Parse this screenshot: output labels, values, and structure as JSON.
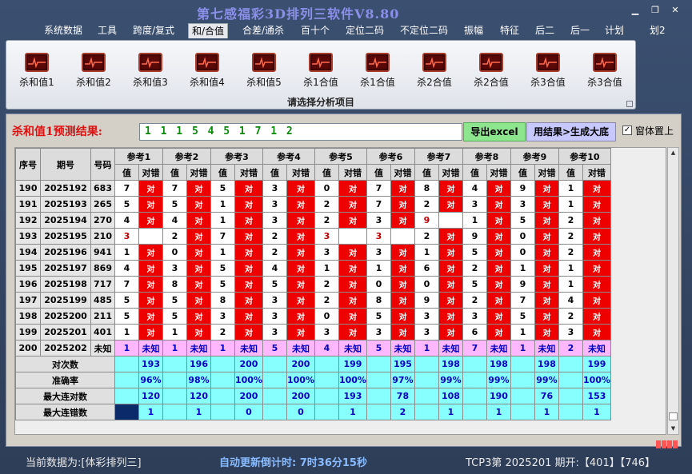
{
  "app": {
    "title": "第七感福彩3D排列三软件V8.80"
  },
  "menu": [
    "系统数据",
    "工具",
    "跨度/复式",
    "和/合值",
    "合差/通杀",
    "百十个",
    "定位二码",
    "不定位二码",
    "振幅",
    "特征",
    "后二",
    "后一",
    "计划",
    "划2"
  ],
  "ribbon": {
    "buttons": [
      "杀和值1",
      "杀和值2",
      "杀和值3",
      "杀和值4",
      "杀和值5",
      "杀1合值",
      "杀1合值",
      "杀2合值",
      "杀2合值",
      "杀3合值",
      "杀3合值"
    ],
    "caption": "请选择分析项目"
  },
  "result": {
    "label": "杀和值1预测结果:",
    "value": "1 1 1 5 4 5 1 7 1 2",
    "excel_btn": "导出excel",
    "gen_btn": "用结果>生成大底",
    "ontop_label": "窗体置上",
    "ontop_checked": "✓"
  },
  "table": {
    "headers": {
      "seq": "序号",
      "period": "期号",
      "number": "号码",
      "refs": [
        "参考1",
        "参考2",
        "参考3",
        "参考4",
        "参考5",
        "参考6",
        "参考7",
        "参考8",
        "参考9",
        "参考10"
      ],
      "val": "值",
      "judge": "对错"
    },
    "ok_text": "对",
    "rows": [
      {
        "seq": "190",
        "period": "2025192",
        "number": "683",
        "vals": [
          "7",
          "7",
          "5",
          "3",
          "0",
          "7",
          "8",
          "4",
          "9",
          "1"
        ],
        "ok": [
          1,
          1,
          1,
          1,
          1,
          1,
          1,
          1,
          1,
          1
        ]
      },
      {
        "seq": "191",
        "period": "2025193",
        "number": "265",
        "vals": [
          "5",
          "5",
          "1",
          "3",
          "2",
          "7",
          "2",
          "3",
          "3",
          "1"
        ],
        "ok": [
          1,
          1,
          1,
          1,
          1,
          1,
          1,
          1,
          1,
          1
        ]
      },
      {
        "seq": "192",
        "period": "2025194",
        "number": "270",
        "vals": [
          "4",
          "4",
          "1",
          "3",
          "2",
          "3",
          "9",
          "1",
          "5",
          "2"
        ],
        "ok": [
          1,
          1,
          1,
          1,
          1,
          1,
          0,
          1,
          1,
          1
        ]
      },
      {
        "seq": "193",
        "period": "2025195",
        "number": "210",
        "vals": [
          "3",
          "2",
          "7",
          "2",
          "3",
          "3",
          "2",
          "9",
          "0",
          "2"
        ],
        "ok": [
          0,
          1,
          1,
          1,
          0,
          0,
          1,
          1,
          1,
          1
        ]
      },
      {
        "seq": "194",
        "period": "2025196",
        "number": "941",
        "vals": [
          "1",
          "0",
          "1",
          "2",
          "3",
          "3",
          "1",
          "5",
          "0",
          "2"
        ],
        "ok": [
          1,
          1,
          1,
          1,
          1,
          1,
          1,
          1,
          1,
          1
        ]
      },
      {
        "seq": "195",
        "period": "2025197",
        "number": "869",
        "vals": [
          "4",
          "3",
          "5",
          "4",
          "1",
          "1",
          "6",
          "2",
          "1",
          "1"
        ],
        "ok": [
          1,
          1,
          1,
          1,
          1,
          1,
          1,
          1,
          1,
          1
        ]
      },
      {
        "seq": "196",
        "period": "2025198",
        "number": "717",
        "vals": [
          "7",
          "8",
          "5",
          "5",
          "2",
          "0",
          "0",
          "5",
          "9",
          "1"
        ],
        "ok": [
          1,
          1,
          1,
          1,
          1,
          1,
          1,
          1,
          1,
          1
        ]
      },
      {
        "seq": "197",
        "period": "2025199",
        "number": "485",
        "vals": [
          "5",
          "5",
          "8",
          "3",
          "2",
          "8",
          "9",
          "2",
          "7",
          "4"
        ],
        "ok": [
          1,
          1,
          1,
          1,
          1,
          1,
          1,
          1,
          1,
          1
        ]
      },
      {
        "seq": "198",
        "period": "2025200",
        "number": "211",
        "vals": [
          "5",
          "5",
          "3",
          "3",
          "0",
          "5",
          "3",
          "3",
          "5",
          "2"
        ],
        "ok": [
          1,
          1,
          1,
          1,
          1,
          1,
          1,
          1,
          1,
          1
        ]
      },
      {
        "seq": "199",
        "period": "2025201",
        "number": "401",
        "vals": [
          "1",
          "1",
          "2",
          "3",
          "3",
          "3",
          "3",
          "6",
          "1",
          "3"
        ],
        "ok": [
          1,
          1,
          1,
          1,
          1,
          1,
          1,
          1,
          1,
          1
        ]
      }
    ],
    "predict": {
      "seq": "200",
      "period": "2025202",
      "number": "未知",
      "vals": [
        "1",
        "1",
        "1",
        "5",
        "4",
        "5",
        "1",
        "7",
        "1",
        "2"
      ],
      "status": "未知"
    },
    "stats": [
      {
        "label": "对次数",
        "values": [
          "193",
          "196",
          "200",
          "200",
          "199",
          "195",
          "198",
          "198",
          "198",
          "199"
        ]
      },
      {
        "label": "准确率",
        "values": [
          "96%",
          "98%",
          "100%",
          "100%",
          "100%",
          "97%",
          "99%",
          "99%",
          "99%",
          "100%"
        ]
      },
      {
        "label": "最大连对数",
        "values": [
          "120",
          "120",
          "200",
          "200",
          "193",
          "78",
          "108",
          "190",
          "76",
          "153"
        ]
      },
      {
        "label": "最大连错数",
        "values": [
          "1",
          "1",
          "0",
          "0",
          "1",
          "2",
          "1",
          "1",
          "1",
          "1"
        ]
      }
    ]
  },
  "status": {
    "current": "当前数据为:[体彩排列三]",
    "countdown": "自动更新倒计时: 7时36分15秒",
    "info": "TCP3第 2025201 期开:【401】【746】"
  }
}
